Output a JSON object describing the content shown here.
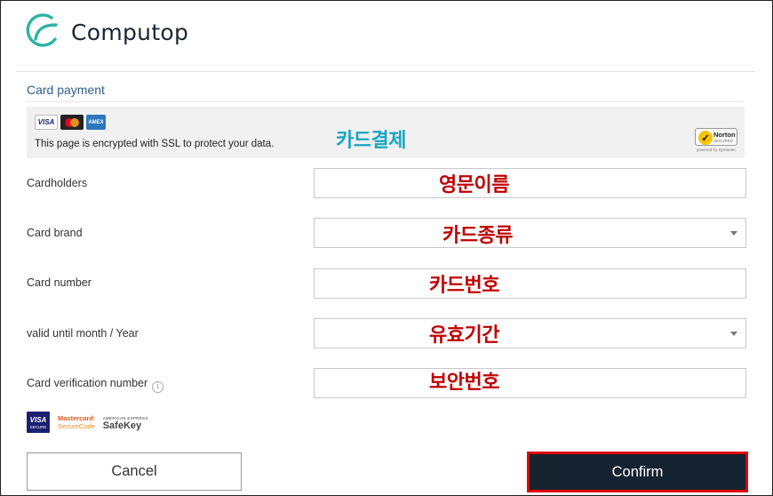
{
  "brand": {
    "name": "Computop"
  },
  "payment": {
    "section_title": "Card payment",
    "card_icons": [
      "VISA",
      "mastercard",
      "AMEX"
    ],
    "ssl_text": "This page is encrypted with SSL to protect your data.",
    "ssl_annotation": "카드결제",
    "norton": {
      "name": "Norton",
      "sub": "SECURED",
      "footer": "powered by Symantec"
    }
  },
  "form": {
    "cardholders": {
      "label": "Cardholders",
      "value": "",
      "annotation": "영문이름"
    },
    "card_brand": {
      "label": "Card brand",
      "value": "",
      "annotation": "카드종류"
    },
    "card_number": {
      "label": "Card number",
      "value": "",
      "annotation": "카드번호"
    },
    "valid_until": {
      "label": "valid until month / Year",
      "value": "",
      "annotation": "유효기간"
    },
    "cvn": {
      "label": "Card verification number",
      "value": "",
      "annotation": "보안번호",
      "info_glyph": "i"
    }
  },
  "secure_logos": {
    "visa": {
      "line1": "VISA",
      "line2": "SECURE"
    },
    "mastercard": {
      "line1": "Mastercard",
      "line2": "SecureCode"
    },
    "amex": {
      "line1": "AMERICAN EXPRESS",
      "line2": "SafeKey"
    }
  },
  "buttons": {
    "cancel": "Cancel",
    "confirm": "Confirm"
  },
  "colors": {
    "title_blue": "#2d5e93",
    "annotation_red": "#c00000",
    "annotation_cyan": "#17a6bf",
    "confirm_bg": "#162230",
    "highlight_red": "#e00000",
    "logo_teal": "#2bb3a3"
  }
}
